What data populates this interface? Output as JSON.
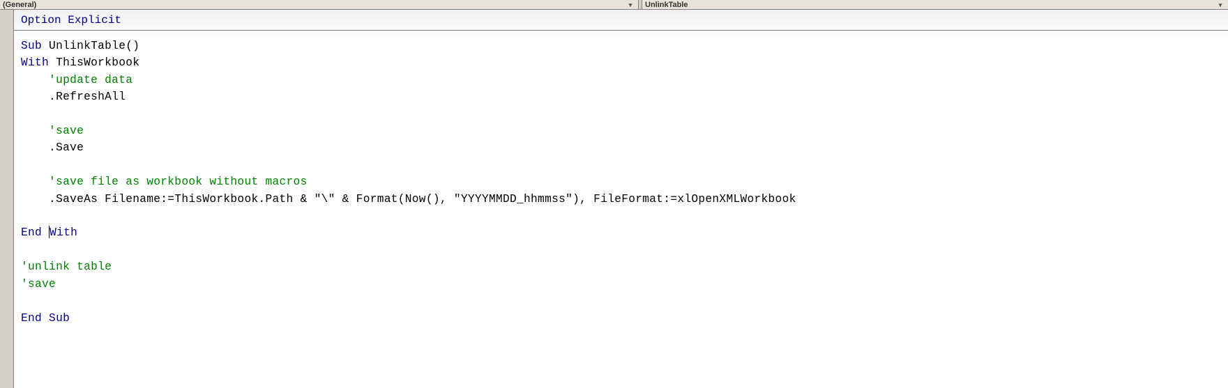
{
  "dropdowns": {
    "object": "(General)",
    "procedure": "UnlinkTable"
  },
  "code": {
    "declaration": {
      "t1": "Option Explicit"
    },
    "lines": {
      "l1_kw": "Sub",
      "l1_rest": " UnlinkTable()",
      "l2_kw": "With",
      "l2_rest": " ThisWorkbook",
      "l3": "    'update data",
      "l4": "    .RefreshAll",
      "l5": "",
      "l6": "    'save",
      "l7": "    .Save",
      "l8": "",
      "l9": "    'save file as workbook without macros",
      "l10a": "    .SaveAs Filename:=ThisWorkbook.Path & ",
      "l10s1": "\"\\\"",
      "l10b": " & Format(Now(), ",
      "l10s2": "\"YYYYMMDD_hhmmss\"",
      "l10c": "), FileFormat:=xlOpenXMLWorkbook",
      "l11": "",
      "l12a": "End ",
      "l12b": "With",
      "l13": "",
      "l14": "'unlink table",
      "l15": "'save",
      "l16": "",
      "l17": "End Sub"
    }
  }
}
